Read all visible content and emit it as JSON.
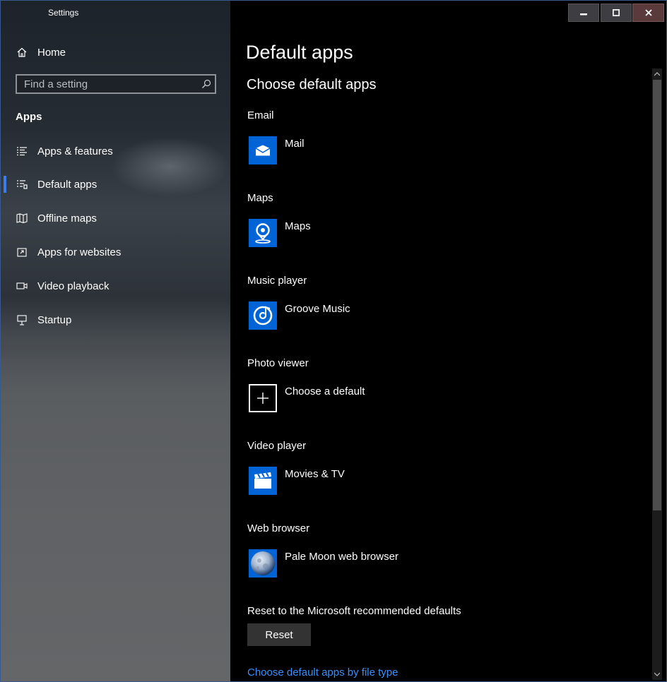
{
  "window": {
    "title": "Settings"
  },
  "sidebar": {
    "home_label": "Home",
    "search_placeholder": "Find a setting",
    "section": "Apps",
    "items": [
      {
        "label": "Apps & features",
        "icon": "list-icon",
        "selected": false
      },
      {
        "label": "Default apps",
        "icon": "default-apps-icon",
        "selected": true
      },
      {
        "label": "Offline maps",
        "icon": "map-icon",
        "selected": false
      },
      {
        "label": "Apps for websites",
        "icon": "open-in-app-icon",
        "selected": false
      },
      {
        "label": "Video playback",
        "icon": "video-camera-icon",
        "selected": false
      },
      {
        "label": "Startup",
        "icon": "startup-icon",
        "selected": false
      }
    ]
  },
  "main": {
    "title": "Default apps",
    "subtitle": "Choose default apps",
    "defaults": [
      {
        "category": "Email",
        "app": "Mail",
        "icon": "mail-icon"
      },
      {
        "category": "Maps",
        "app": "Maps",
        "icon": "maps-pin-icon"
      },
      {
        "category": "Music player",
        "app": "Groove Music",
        "icon": "groove-music-icon"
      },
      {
        "category": "Photo viewer",
        "app": "Choose a default",
        "icon": "plus-icon"
      },
      {
        "category": "Video player",
        "app": "Movies & TV",
        "icon": "clapperboard-icon"
      },
      {
        "category": "Web browser",
        "app": "Pale Moon web browser",
        "icon": "pale-moon-icon"
      }
    ],
    "reset_label": "Reset to the Microsoft recommended defaults",
    "reset_button": "Reset",
    "file_type_link": "Choose default apps by file type"
  },
  "colors": {
    "accent": "#0063d6",
    "link": "#3a8fff",
    "selection_bar": "#3b7ded"
  }
}
